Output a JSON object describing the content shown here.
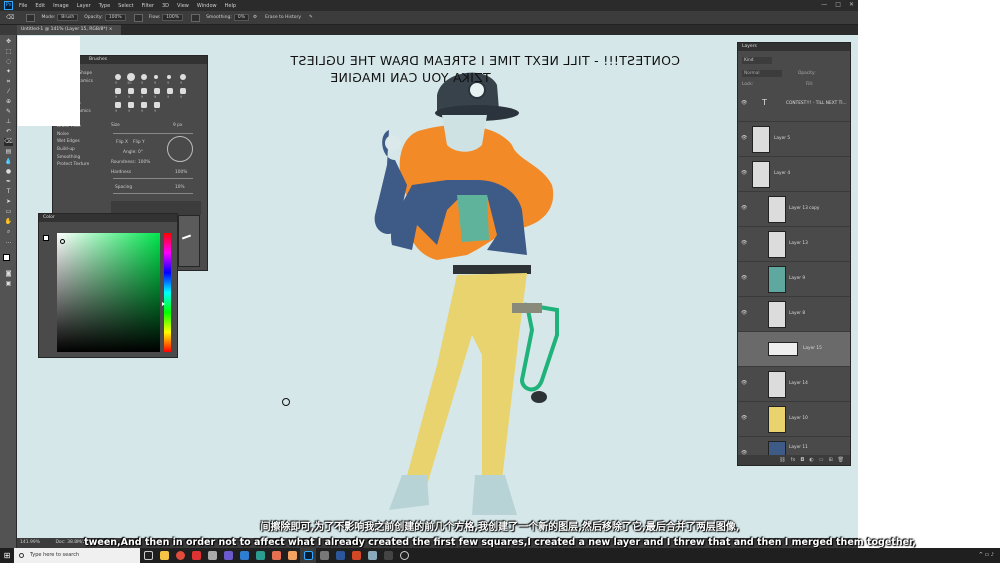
{
  "menubar": {
    "logo": "Ps",
    "items": [
      "File",
      "Edit",
      "Image",
      "Layer",
      "Type",
      "Select",
      "Filter",
      "3D",
      "View",
      "Window",
      "Help"
    ],
    "window_controls": [
      "—",
      "□",
      "✕"
    ]
  },
  "options_bar": {
    "mode_label": "Mode:",
    "mode_value": "Brush",
    "opacity_label": "Opacity:",
    "opacity_value": "100%",
    "flow_label": "Flow:",
    "flow_value": "100%",
    "smoothing_label": "Smoothing:",
    "smoothing_value": "0%",
    "erase_history": "Erase to History"
  },
  "document_tab": "Untitled-1 @ 141% (Layer 15, RGB/8*) ×",
  "canvas_text": {
    "line1": "CONTEST!!! - TILL NEXT TIME I STREAM DRAW THE UGLIEST",
    "line2": "TZIKA YOU CAN IMAGINE"
  },
  "brushes_panel": {
    "title": "Brushes",
    "options": [
      "Brush Tip Shape",
      "Shape Dynamics",
      "Scattering",
      "Texture",
      "Dual Brush",
      "Color Dynamics",
      "Transfer",
      "Brush Pose",
      "Noise",
      "Wet Edges",
      "Build-up",
      "Smoothing",
      "Protect Texture"
    ],
    "brush_sizes": [
      "9",
      "30",
      "9",
      "9",
      "9",
      "9",
      "9",
      "9",
      "9",
      "9",
      "9",
      "9",
      "9",
      "9",
      "9",
      "9"
    ],
    "size_label": "Size",
    "size_value": "9 px",
    "flip_x": "Flip X",
    "flip_y": "Flip Y",
    "angle_label": "Angle:",
    "angle_value": "0°",
    "roundness_label": "Roundness:",
    "roundness_value": "100%",
    "hardness_label": "Hardness",
    "hardness_value": "100%",
    "spacing_label": "Spacing",
    "spacing_value": "10%"
  },
  "color_panel": {
    "title": "Color",
    "accent": "#00e64d"
  },
  "layers_panel": {
    "title": "Layers",
    "kind_label": "Kind",
    "blend_mode": "Normal",
    "opacity_label": "Opacity:",
    "fill_label": "Fill:",
    "lock_label": "Lock:",
    "layers": [
      {
        "name": "CONTEST!!! - TILL NEXT TI...",
        "type": "text",
        "selected": false
      },
      {
        "name": "Layer 5",
        "type": "pixel",
        "selected": false
      },
      {
        "name": "Layer 4",
        "type": "pixel",
        "selected": false
      },
      {
        "name": "Layer 13 copy",
        "type": "pixel",
        "selected": false
      },
      {
        "name": "Layer 13",
        "type": "pixel",
        "selected": false
      },
      {
        "name": "Layer 9",
        "type": "pixel",
        "selected": false
      },
      {
        "name": "Layer 8",
        "type": "pixel",
        "selected": false
      },
      {
        "name": "Layer 15",
        "type": "pixel",
        "selected": true
      },
      {
        "name": "Layer 14",
        "type": "pixel",
        "selected": false
      },
      {
        "name": "Layer 10",
        "type": "pixel",
        "selected": false
      },
      {
        "name": "Layer 11",
        "type": "pixel",
        "selected": false
      }
    ],
    "footer_icons": [
      "link-icon",
      "fx-icon",
      "mask-icon",
      "adjustment-icon",
      "group-icon",
      "new-layer-icon",
      "trash-icon"
    ]
  },
  "status_bar": {
    "zoom": "141.99%",
    "doc": "Doc: 38.8M/291.3M"
  },
  "subtitles": {
    "zh": "间擦除即可,为了不影响我之前创建的前几个方格,我创建了一个新的图层,然后移除了它,最后合并了两层图像,",
    "en": "tween,And then in order not to affect what I already created the first few squares,I created a new layer and I threw that and then I merged them together,"
  },
  "taskbar": {
    "search_placeholder": "Type here to search",
    "apps": [
      "file-explorer",
      "chrome",
      "media",
      "notes",
      "settings",
      "store",
      "edge",
      "ds",
      "paint",
      "photoshop",
      "camera",
      "word",
      "powerpoint",
      "clip",
      "terminal",
      "obs"
    ]
  }
}
